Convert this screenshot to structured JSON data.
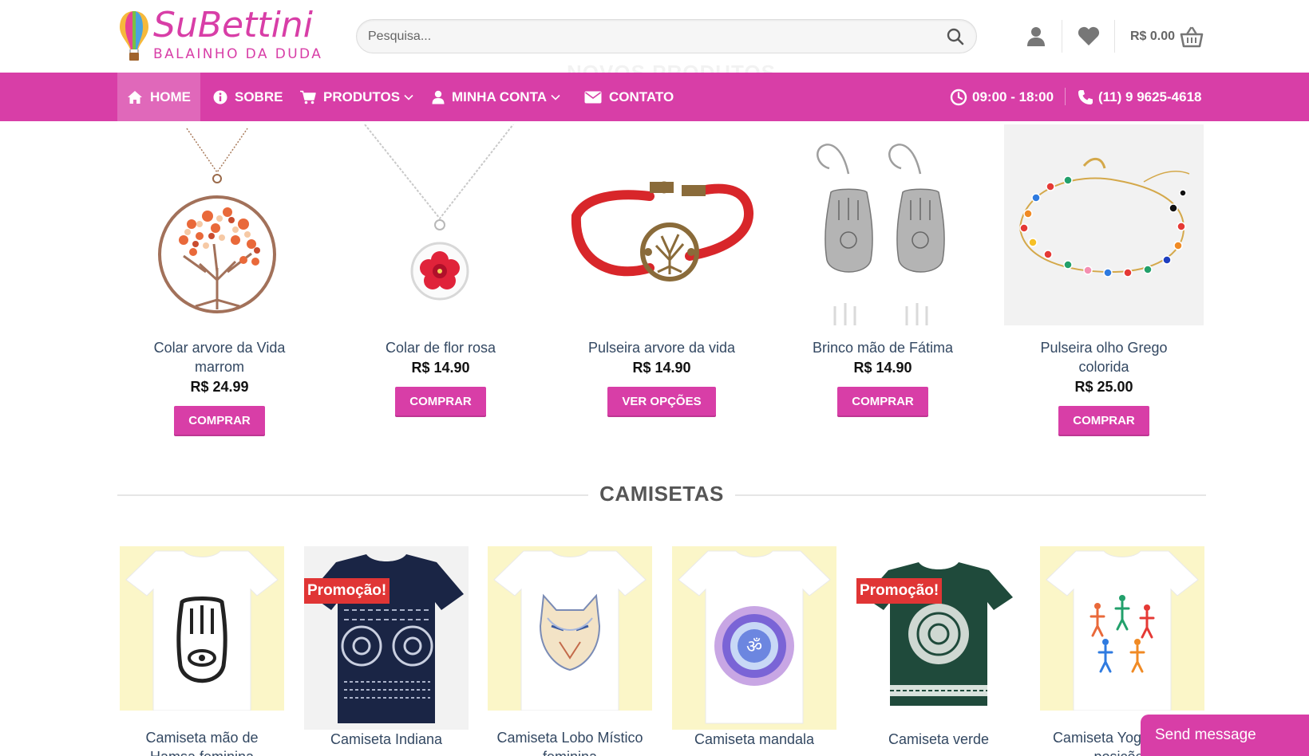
{
  "header": {
    "logo_title": "SuBettini",
    "logo_subtitle": "BALAINHO DA DUDA",
    "search_placeholder": "Pesquisa...",
    "cart_total": "R$ 0.00"
  },
  "nav": {
    "items": [
      {
        "label": "HOME",
        "icon": "home-icon",
        "active": true
      },
      {
        "label": "SOBRE",
        "icon": "info-icon"
      },
      {
        "label": "PRODUTOS",
        "icon": "cart-icon",
        "dropdown": true
      },
      {
        "label": "MINHA CONTA",
        "icon": "user-icon",
        "dropdown": true
      },
      {
        "label": "CONTATO",
        "icon": "envelope-icon"
      }
    ],
    "hours": "09:00 - 18:00",
    "phone": "(11) 9 9625-4618"
  },
  "featured": {
    "ghost_title": "NOVOS PRODUTOS",
    "products": [
      {
        "name": "Colar arvore da Vida marrom",
        "price": "R$ 24.99",
        "button": "COMPRAR"
      },
      {
        "name": "Colar de flor rosa",
        "price": "R$ 14.90",
        "button": "COMPRAR"
      },
      {
        "name": "Pulseira arvore da vida",
        "price": "R$ 14.90",
        "button": "VER OPÇÕES"
      },
      {
        "name": "Brinco mão de Fátima",
        "price": "R$ 14.90",
        "button": "COMPRAR"
      },
      {
        "name": "Pulseira olho Grego colorida",
        "price": "R$ 25.00",
        "button": "COMPRAR"
      }
    ]
  },
  "camisetas": {
    "title": "CAMISETAS",
    "promo_label": "Promoção!",
    "items": [
      {
        "name": "Camiseta mão de Hamsa feminina",
        "promo": false
      },
      {
        "name": "Camiseta Indiana",
        "promo": true
      },
      {
        "name": "Camiseta Lobo Místico feminina",
        "promo": false
      },
      {
        "name": "Camiseta mandala",
        "promo": false
      },
      {
        "name": "Camiseta verde",
        "promo": true
      },
      {
        "name": "Camiseta Yoga várias posições",
        "promo": false
      }
    ]
  },
  "chat": {
    "label": "Send message"
  },
  "colors": {
    "brand": "#d83ea7",
    "promo": "#e03535",
    "link": "#334862"
  }
}
